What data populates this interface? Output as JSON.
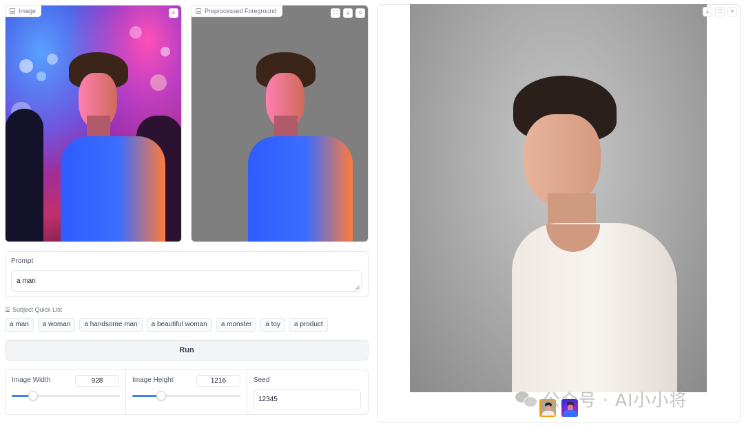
{
  "input_image": {
    "label": "Image",
    "close_icon": "×"
  },
  "foreground_image": {
    "label": "Preprocessed Foreground",
    "fullscreen_icon": "⛶",
    "download_icon": "⤓",
    "share_icon": "<"
  },
  "output_image": {
    "download_icon": "⤓",
    "fullscreen_icon": "⛶",
    "close_icon": "×"
  },
  "prompt": {
    "label": "Prompt",
    "value": "a man"
  },
  "quick_list": {
    "label": "Subject Quick List",
    "items": [
      "a man",
      "a woman",
      "a handsome man",
      "a beautiful woman",
      "a monster",
      "a toy",
      "a product"
    ]
  },
  "run": {
    "label": "Run"
  },
  "params": {
    "width": {
      "label": "Image Width",
      "value": "928",
      "fraction": 0.2
    },
    "height": {
      "label": "Image Height",
      "value": "1216",
      "fraction": 0.27
    },
    "seed": {
      "label": "Seed",
      "value": "12345"
    }
  },
  "watermark": {
    "text": "公众号 · AI小小将"
  },
  "colors": {
    "accent": "#3b82f6",
    "border": "#e5e7eb",
    "button_bg": "#f3f4f6"
  }
}
